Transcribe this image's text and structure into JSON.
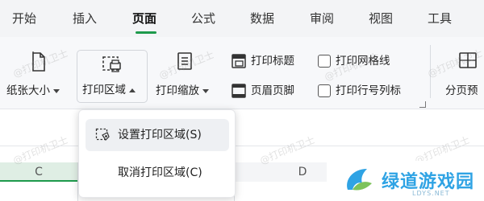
{
  "tabs": [
    {
      "label": "开始"
    },
    {
      "label": "插入"
    },
    {
      "label": "页面"
    },
    {
      "label": "公式"
    },
    {
      "label": "数据"
    },
    {
      "label": "审阅"
    },
    {
      "label": "视图"
    },
    {
      "label": "工具"
    }
  ],
  "active_tab": "页面",
  "ribbon": {
    "paper_size": "纸张大小",
    "print_area": "打印区域",
    "print_scale": "打印缩放",
    "print_titles": "打印标题",
    "header_footer": "页眉页脚",
    "print_gridlines": "打印网格线",
    "print_row_col_headers": "打印行号列标",
    "page_break_preview": "分页预"
  },
  "checkboxes": {
    "print_gridlines_checked": false,
    "print_row_col_headers_checked": false
  },
  "dropdown": {
    "set_print_area": "设置打印区域(S)",
    "cancel_print_area": "取消打印区域(C)"
  },
  "columns": {
    "c": "C",
    "d": "D"
  },
  "watermark": "@打印机卫士",
  "logo": {
    "name": "绿道游戏园",
    "subtitle": "LDYS.NET"
  },
  "colors": {
    "accent": "#1e9a4c",
    "logo": "#2fa3e4"
  }
}
